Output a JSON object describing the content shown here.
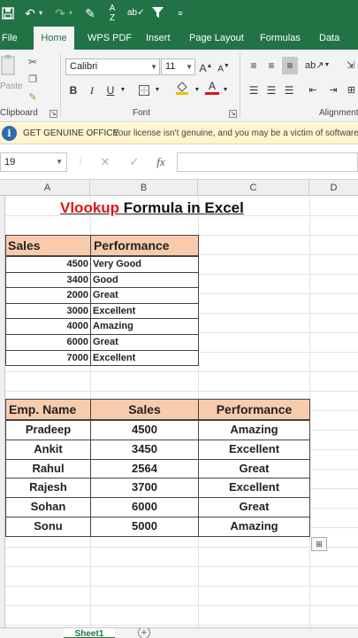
{
  "colors": {
    "excel_green": "#217346",
    "header_fill": "#f8cbad",
    "title_red": "#e0121a",
    "message_bar": "#fff4ce"
  },
  "qat": {
    "icons": [
      "save-icon",
      "undo-icon",
      "redo-icon",
      "format-painter-icon",
      "sort-icon",
      "spelling-icon",
      "filter-icon",
      "customize-icon"
    ]
  },
  "tabs": [
    "File",
    "Home",
    "WPS PDF",
    "Insert",
    "Page Layout",
    "Formulas",
    "Data"
  ],
  "ribbon": {
    "clipboard_label": "Clipboard",
    "paste_label": "Paste",
    "font_label": "Font",
    "alignment_label": "Alignment",
    "font_name": "Calibri",
    "font_size": "11",
    "bold": "B",
    "italic": "I",
    "underline": "U",
    "grow_font": "A",
    "shrink_font": "A",
    "font_color": "A"
  },
  "message_bar": {
    "title": "GET GENUINE OFFICE",
    "text": "Your license isn't genuine, and you may be a victim of software counterfeiting."
  },
  "formula_bar": {
    "name_box": "19",
    "fx": "fx",
    "content": ""
  },
  "columns": [
    "A",
    "B",
    "C",
    "D"
  ],
  "sheet": {
    "title_red": "Vlookup",
    "title_rest": " Formula in Excel",
    "table1": {
      "headers": [
        "Sales",
        "Performance"
      ],
      "rows": [
        [
          "4500",
          "Very Good"
        ],
        [
          "3400",
          "Good"
        ],
        [
          "2000",
          "Great"
        ],
        [
          "3000",
          "Excellent"
        ],
        [
          "4000",
          "Amazing"
        ],
        [
          "6000",
          "Great"
        ],
        [
          "7000",
          "Excellent"
        ]
      ]
    },
    "table2": {
      "headers": [
        "Emp. Name",
        "Sales",
        "Performance"
      ],
      "rows": [
        [
          "Pradeep",
          "4500",
          "Amazing"
        ],
        [
          "Ankit",
          "3450",
          "Excellent"
        ],
        [
          "Rahul",
          "2564",
          "Great"
        ],
        [
          "Rajesh",
          "3700",
          "Excellent"
        ],
        [
          "Sohan",
          "6000",
          "Great"
        ],
        [
          "Sonu",
          "5000",
          "Amazing"
        ]
      ]
    }
  },
  "sheet_tabs": {
    "active": "Sheet1",
    "add": "+"
  }
}
